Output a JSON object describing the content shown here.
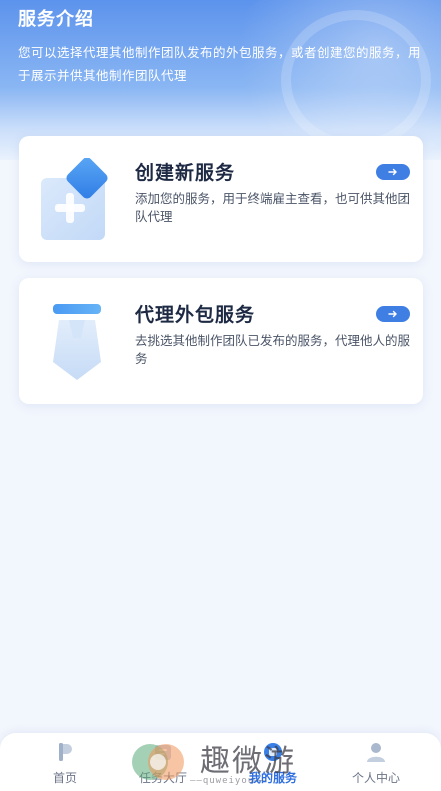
{
  "header": {
    "title": "服务介绍",
    "description": "您可以选择代理其他制作团队发布的外包服务，或者创建您的服务，用于展示并供其他制作团队代理"
  },
  "cards": [
    {
      "title": "创建新服务",
      "description": "添加您的服务，用于终端雇主查看，也可供其他团队代理",
      "icon": "create-service-icon"
    },
    {
      "title": "代理外包服务",
      "description": "去挑选其他制作团队已发布的服务，代理他人的服务",
      "icon": "proxy-service-icon"
    }
  ],
  "tabbar": {
    "items": [
      {
        "label": "首页",
        "icon": "home-icon",
        "active": false
      },
      {
        "label": "任务大厅",
        "icon": "task-hall-icon",
        "active": false
      },
      {
        "label": "我的服务",
        "icon": "my-service-icon",
        "active": true
      },
      {
        "label": "个人中心",
        "icon": "profile-icon",
        "active": false
      }
    ]
  },
  "watermark": {
    "text": "趣微游",
    "subtext": "——quweiyou——"
  },
  "colors": {
    "accent": "#3f7fe4",
    "header_gradient_top": "#5c93ec",
    "background": "#f2f6fd",
    "active_tab": "#2f6fe0"
  }
}
